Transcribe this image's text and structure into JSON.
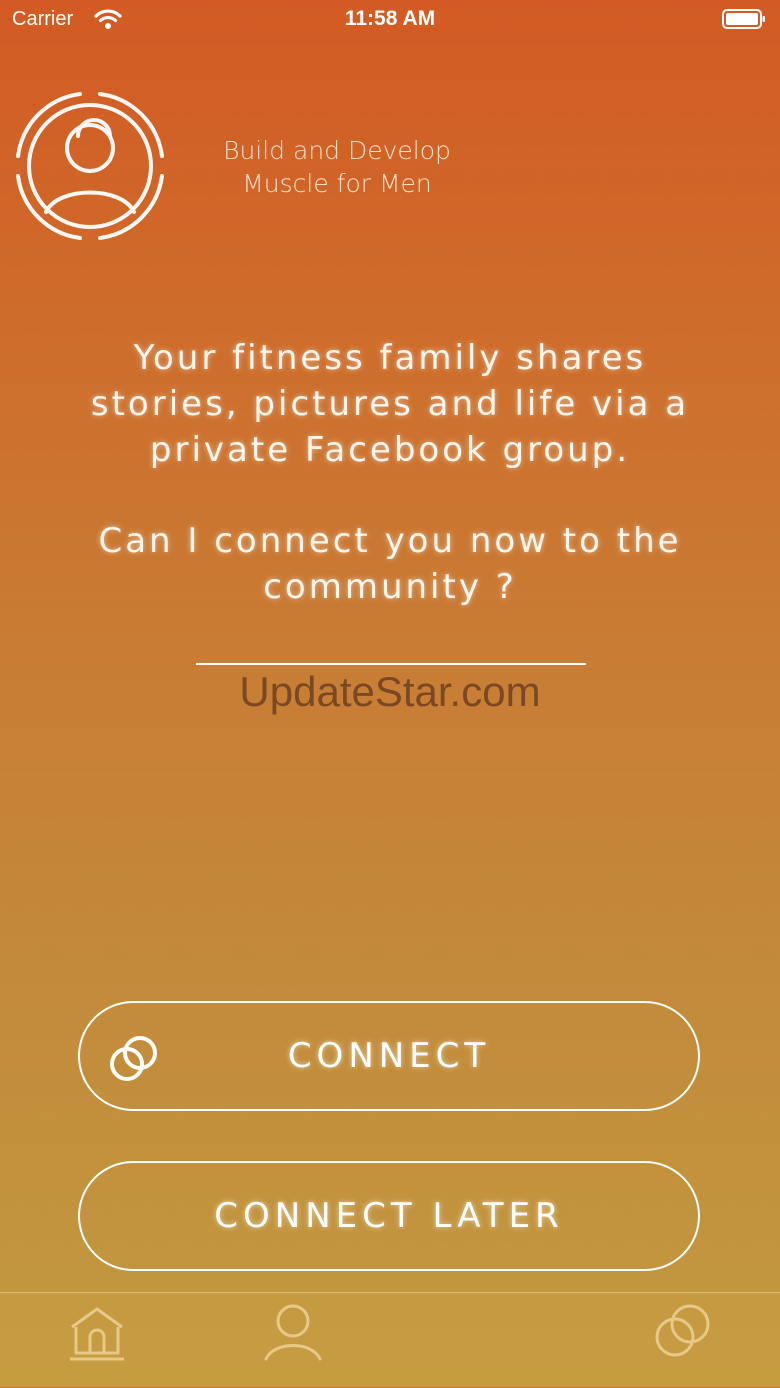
{
  "status_bar": {
    "carrier": "Carrier",
    "time": "11:58 AM",
    "icons": [
      "wifi-icon",
      "battery-icon"
    ]
  },
  "header": {
    "logo_icon": "person-rings-logo",
    "tagline_line1": "Build and Develop",
    "tagline_line2": "Muscle for Men"
  },
  "message": {
    "line1": "Your fitness family shares",
    "line2": "stories, pictures and life via a",
    "line3": "private Facebook group.",
    "line4": "Can I connect you now to the",
    "line5": "community ?"
  },
  "watermark": "UpdateStar.com",
  "buttons": {
    "connect_label": "CONNECT",
    "connect_icon": "rings-icon",
    "connect_later_label": "CONNECT LATER"
  },
  "tab_bar": {
    "items": [
      {
        "name": "home",
        "icon": "home-icon"
      },
      {
        "name": "profile",
        "icon": "person-icon"
      },
      {
        "name": "community",
        "icon": "rings-icon"
      }
    ]
  },
  "colors": {
    "gradient_top": "#d35a24",
    "gradient_bottom": "#c29a40",
    "text": "#ffffff",
    "watermark": "#7a4824"
  }
}
